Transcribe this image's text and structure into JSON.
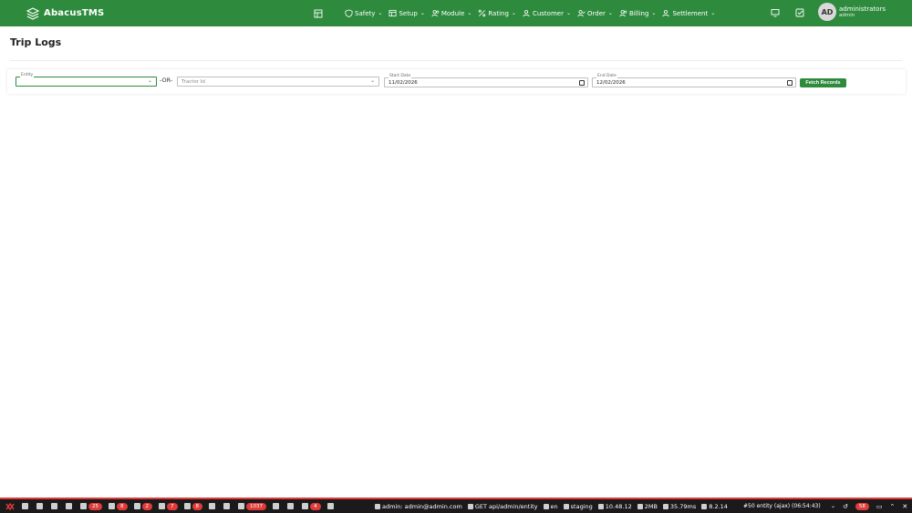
{
  "app": {
    "brand": "AbacusTMS"
  },
  "nav": {
    "items": [
      {
        "label": "Safety",
        "icon": "shield-icon"
      },
      {
        "label": "Setup",
        "icon": "table-icon"
      },
      {
        "label": "Module",
        "icon": "users-icon"
      },
      {
        "label": "Rating",
        "icon": "percent-icon"
      },
      {
        "label": "Customer",
        "icon": "user-icon"
      },
      {
        "label": "Order",
        "icon": "user-check-icon"
      },
      {
        "label": "Billing",
        "icon": "users-icon"
      },
      {
        "label": "Settlement",
        "icon": "user-icon"
      }
    ]
  },
  "user": {
    "initials": "AD",
    "name": "administrators",
    "role": "admin"
  },
  "page": {
    "title": "Trip Logs"
  },
  "filters": {
    "entity_label": "Entity",
    "entity_value": "",
    "or_text": "-OR-",
    "tractor_placeholder": "Tractor Id",
    "start_label": "Start Date",
    "start_value": "11/02/2026",
    "end_label": "End Date",
    "end_value": "12/02/2026",
    "fetch_label": "Fetch Records"
  },
  "debugbar": {
    "badges": [
      "25",
      "8",
      "2",
      "7",
      "8",
      "1037",
      "4"
    ],
    "user_info": "admin: admin@admin.com",
    "route": "GET api/admin/entity",
    "locale": "en",
    "env": "staging",
    "php_version": "10.48.12",
    "memory": "2MB",
    "time": "35.79ms",
    "laravel_version": "8.2.14",
    "request": "#50 entity (ajax) (06:54:43)",
    "request_count": "58"
  },
  "colors": {
    "primary": "#2e8b3d",
    "debug_accent": "#e03a3a"
  }
}
